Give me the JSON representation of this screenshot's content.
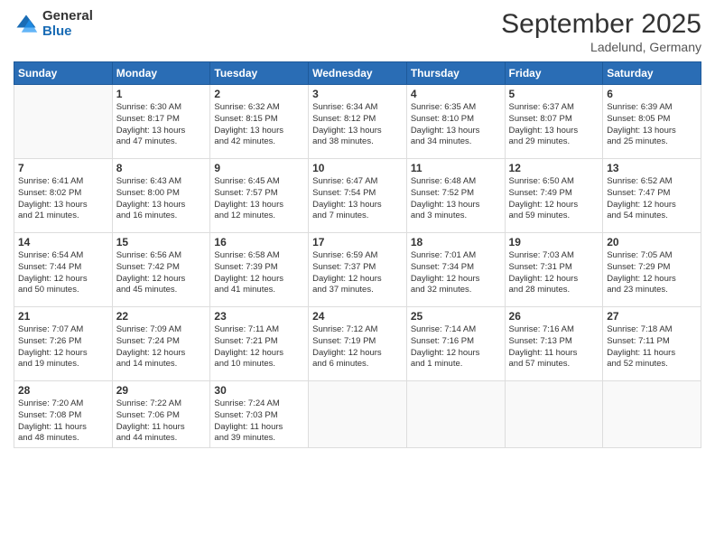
{
  "logo": {
    "general": "General",
    "blue": "Blue"
  },
  "title": {
    "month": "September 2025",
    "location": "Ladelund, Germany"
  },
  "weekdays": [
    "Sunday",
    "Monday",
    "Tuesday",
    "Wednesday",
    "Thursday",
    "Friday",
    "Saturday"
  ],
  "weeks": [
    [
      {
        "day": "",
        "info": ""
      },
      {
        "day": "1",
        "info": "Sunrise: 6:30 AM\nSunset: 8:17 PM\nDaylight: 13 hours\nand 47 minutes."
      },
      {
        "day": "2",
        "info": "Sunrise: 6:32 AM\nSunset: 8:15 PM\nDaylight: 13 hours\nand 42 minutes."
      },
      {
        "day": "3",
        "info": "Sunrise: 6:34 AM\nSunset: 8:12 PM\nDaylight: 13 hours\nand 38 minutes."
      },
      {
        "day": "4",
        "info": "Sunrise: 6:35 AM\nSunset: 8:10 PM\nDaylight: 13 hours\nand 34 minutes."
      },
      {
        "day": "5",
        "info": "Sunrise: 6:37 AM\nSunset: 8:07 PM\nDaylight: 13 hours\nand 29 minutes."
      },
      {
        "day": "6",
        "info": "Sunrise: 6:39 AM\nSunset: 8:05 PM\nDaylight: 13 hours\nand 25 minutes."
      }
    ],
    [
      {
        "day": "7",
        "info": "Sunrise: 6:41 AM\nSunset: 8:02 PM\nDaylight: 13 hours\nand 21 minutes."
      },
      {
        "day": "8",
        "info": "Sunrise: 6:43 AM\nSunset: 8:00 PM\nDaylight: 13 hours\nand 16 minutes."
      },
      {
        "day": "9",
        "info": "Sunrise: 6:45 AM\nSunset: 7:57 PM\nDaylight: 13 hours\nand 12 minutes."
      },
      {
        "day": "10",
        "info": "Sunrise: 6:47 AM\nSunset: 7:54 PM\nDaylight: 13 hours\nand 7 minutes."
      },
      {
        "day": "11",
        "info": "Sunrise: 6:48 AM\nSunset: 7:52 PM\nDaylight: 13 hours\nand 3 minutes."
      },
      {
        "day": "12",
        "info": "Sunrise: 6:50 AM\nSunset: 7:49 PM\nDaylight: 12 hours\nand 59 minutes."
      },
      {
        "day": "13",
        "info": "Sunrise: 6:52 AM\nSunset: 7:47 PM\nDaylight: 12 hours\nand 54 minutes."
      }
    ],
    [
      {
        "day": "14",
        "info": "Sunrise: 6:54 AM\nSunset: 7:44 PM\nDaylight: 12 hours\nand 50 minutes."
      },
      {
        "day": "15",
        "info": "Sunrise: 6:56 AM\nSunset: 7:42 PM\nDaylight: 12 hours\nand 45 minutes."
      },
      {
        "day": "16",
        "info": "Sunrise: 6:58 AM\nSunset: 7:39 PM\nDaylight: 12 hours\nand 41 minutes."
      },
      {
        "day": "17",
        "info": "Sunrise: 6:59 AM\nSunset: 7:37 PM\nDaylight: 12 hours\nand 37 minutes."
      },
      {
        "day": "18",
        "info": "Sunrise: 7:01 AM\nSunset: 7:34 PM\nDaylight: 12 hours\nand 32 minutes."
      },
      {
        "day": "19",
        "info": "Sunrise: 7:03 AM\nSunset: 7:31 PM\nDaylight: 12 hours\nand 28 minutes."
      },
      {
        "day": "20",
        "info": "Sunrise: 7:05 AM\nSunset: 7:29 PM\nDaylight: 12 hours\nand 23 minutes."
      }
    ],
    [
      {
        "day": "21",
        "info": "Sunrise: 7:07 AM\nSunset: 7:26 PM\nDaylight: 12 hours\nand 19 minutes."
      },
      {
        "day": "22",
        "info": "Sunrise: 7:09 AM\nSunset: 7:24 PM\nDaylight: 12 hours\nand 14 minutes."
      },
      {
        "day": "23",
        "info": "Sunrise: 7:11 AM\nSunset: 7:21 PM\nDaylight: 12 hours\nand 10 minutes."
      },
      {
        "day": "24",
        "info": "Sunrise: 7:12 AM\nSunset: 7:19 PM\nDaylight: 12 hours\nand 6 minutes."
      },
      {
        "day": "25",
        "info": "Sunrise: 7:14 AM\nSunset: 7:16 PM\nDaylight: 12 hours\nand 1 minute."
      },
      {
        "day": "26",
        "info": "Sunrise: 7:16 AM\nSunset: 7:13 PM\nDaylight: 11 hours\nand 57 minutes."
      },
      {
        "day": "27",
        "info": "Sunrise: 7:18 AM\nSunset: 7:11 PM\nDaylight: 11 hours\nand 52 minutes."
      }
    ],
    [
      {
        "day": "28",
        "info": "Sunrise: 7:20 AM\nSunset: 7:08 PM\nDaylight: 11 hours\nand 48 minutes."
      },
      {
        "day": "29",
        "info": "Sunrise: 7:22 AM\nSunset: 7:06 PM\nDaylight: 11 hours\nand 44 minutes."
      },
      {
        "day": "30",
        "info": "Sunrise: 7:24 AM\nSunset: 7:03 PM\nDaylight: 11 hours\nand 39 minutes."
      },
      {
        "day": "",
        "info": ""
      },
      {
        "day": "",
        "info": ""
      },
      {
        "day": "",
        "info": ""
      },
      {
        "day": "",
        "info": ""
      }
    ]
  ]
}
